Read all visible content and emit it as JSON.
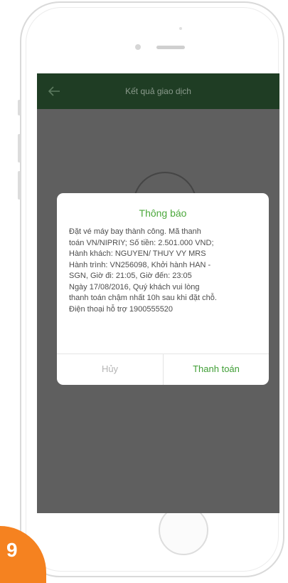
{
  "app": {
    "screen_title": "Kết quả giao dịch"
  },
  "dialog": {
    "title": "Thông báo",
    "lines": [
      "Đặt vé máy bay thành công. Mã thanh",
      "toán VN/NIPRIY; Số tiền: 2.501.000 VND;",
      "Hành khách: NGUYEN/ THUY VY MRS",
      "Hành trình: VN256098, Khởi hành HAN -",
      "SGN, Giờ đi: 21:05, Giờ đến: 23:05",
      "Ngày 17/08/2016, Quý khách vui lòng",
      "thanh toán chậm nhất 10h sau khi đặt chỗ.",
      "Điện thoại hỗ trợ 1900555520"
    ],
    "cancel_label": "Hủy",
    "pay_label": "Thanh toán"
  },
  "step_badge": {
    "number": "9"
  },
  "colors": {
    "accent_green": "#4ca83c",
    "header_green": "#1f3d24",
    "badge_orange": "#f58220"
  },
  "icons": {
    "back": "arrow-left-icon"
  }
}
